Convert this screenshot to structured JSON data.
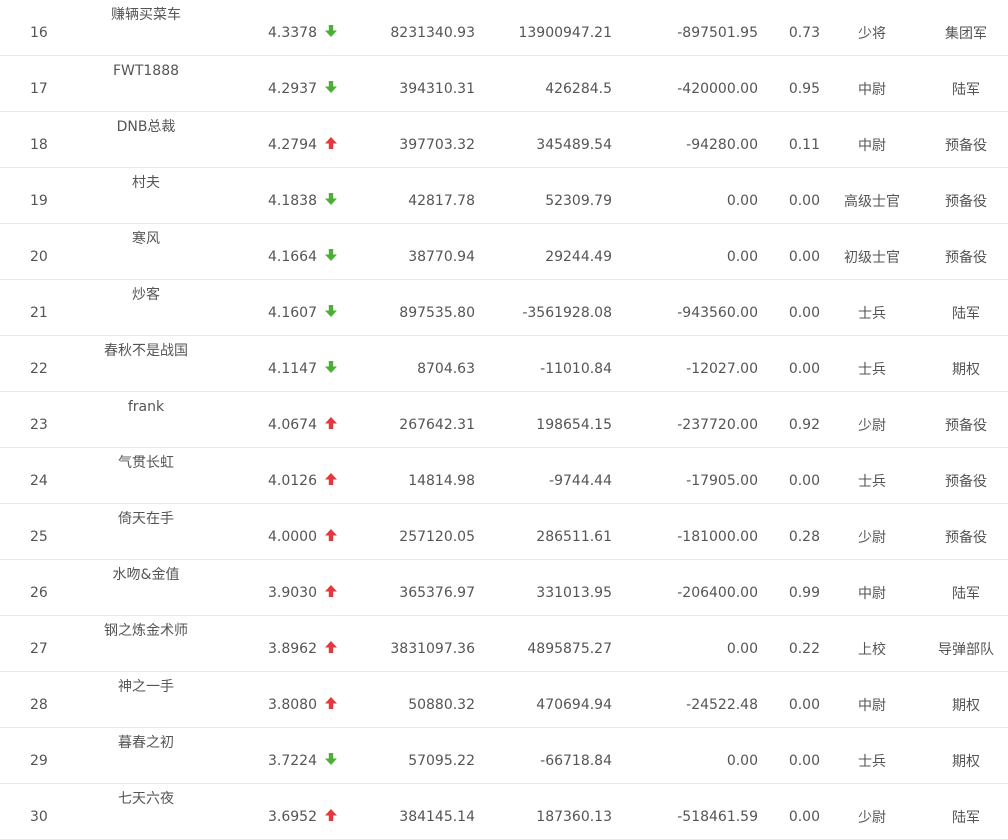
{
  "colors": {
    "up": "#e0393e",
    "down": "#4caf36",
    "text": "#555555",
    "divider": "#e9e9e9"
  },
  "rows": [
    {
      "rank": "16",
      "name": "赚辆买菜车",
      "score": "4.3378",
      "trend": "down",
      "v1": "8231340.93",
      "v2": "13900947.21",
      "v3": "-897501.95",
      "ratio": "0.73",
      "rank_title": "少将",
      "branch": "集团军"
    },
    {
      "rank": "17",
      "name": "FWT1888",
      "score": "4.2937",
      "trend": "down",
      "v1": "394310.31",
      "v2": "426284.5",
      "v3": "-420000.00",
      "ratio": "0.95",
      "rank_title": "中尉",
      "branch": "陆军"
    },
    {
      "rank": "18",
      "name": "DNB总裁",
      "score": "4.2794",
      "trend": "up",
      "v1": "397703.32",
      "v2": "345489.54",
      "v3": "-94280.00",
      "ratio": "0.11",
      "rank_title": "中尉",
      "branch": "预备役"
    },
    {
      "rank": "19",
      "name": "村夫",
      "score": "4.1838",
      "trend": "down",
      "v1": "42817.78",
      "v2": "52309.79",
      "v3": "0.00",
      "ratio": "0.00",
      "rank_title": "高级士官",
      "branch": "预备役"
    },
    {
      "rank": "20",
      "name": "寒风",
      "score": "4.1664",
      "trend": "down",
      "v1": "38770.94",
      "v2": "29244.49",
      "v3": "0.00",
      "ratio": "0.00",
      "rank_title": "初级士官",
      "branch": "预备役"
    },
    {
      "rank": "21",
      "name": "炒客",
      "score": "4.1607",
      "trend": "down",
      "v1": "897535.80",
      "v2": "-3561928.08",
      "v3": "-943560.00",
      "ratio": "0.00",
      "rank_title": "士兵",
      "branch": "陆军"
    },
    {
      "rank": "22",
      "name": "春秋不是战国",
      "score": "4.1147",
      "trend": "down",
      "v1": "8704.63",
      "v2": "-11010.84",
      "v3": "-12027.00",
      "ratio": "0.00",
      "rank_title": "士兵",
      "branch": "期权"
    },
    {
      "rank": "23",
      "name": "frank",
      "score": "4.0674",
      "trend": "up",
      "v1": "267642.31",
      "v2": "198654.15",
      "v3": "-237720.00",
      "ratio": "0.92",
      "rank_title": "少尉",
      "branch": "预备役"
    },
    {
      "rank": "24",
      "name": "气贯长虹",
      "score": "4.0126",
      "trend": "up",
      "v1": "14814.98",
      "v2": "-9744.44",
      "v3": "-17905.00",
      "ratio": "0.00",
      "rank_title": "士兵",
      "branch": "预备役"
    },
    {
      "rank": "25",
      "name": "倚天在手",
      "score": "4.0000",
      "trend": "up",
      "v1": "257120.05",
      "v2": "286511.61",
      "v3": "-181000.00",
      "ratio": "0.28",
      "rank_title": "少尉",
      "branch": "预备役"
    },
    {
      "rank": "26",
      "name": "水吻&金值",
      "score": "3.9030",
      "trend": "up",
      "v1": "365376.97",
      "v2": "331013.95",
      "v3": "-206400.00",
      "ratio": "0.99",
      "rank_title": "中尉",
      "branch": "陆军"
    },
    {
      "rank": "27",
      "name": "钢之炼金术师",
      "score": "3.8962",
      "trend": "up",
      "v1": "3831097.36",
      "v2": "4895875.27",
      "v3": "0.00",
      "ratio": "0.22",
      "rank_title": "上校",
      "branch": "导弹部队"
    },
    {
      "rank": "28",
      "name": "神之一手",
      "score": "3.8080",
      "trend": "up",
      "v1": "50880.32",
      "v2": "470694.94",
      "v3": "-24522.48",
      "ratio": "0.00",
      "rank_title": "中尉",
      "branch": "期权"
    },
    {
      "rank": "29",
      "name": "暮春之初",
      "score": "3.7224",
      "trend": "down",
      "v1": "57095.22",
      "v2": "-66718.84",
      "v3": "0.00",
      "ratio": "0.00",
      "rank_title": "士兵",
      "branch": "期权"
    },
    {
      "rank": "30",
      "name": "七天六夜",
      "score": "3.6952",
      "trend": "up",
      "v1": "384145.14",
      "v2": "187360.13",
      "v3": "-518461.59",
      "ratio": "0.00",
      "rank_title": "少尉",
      "branch": "陆军"
    }
  ]
}
